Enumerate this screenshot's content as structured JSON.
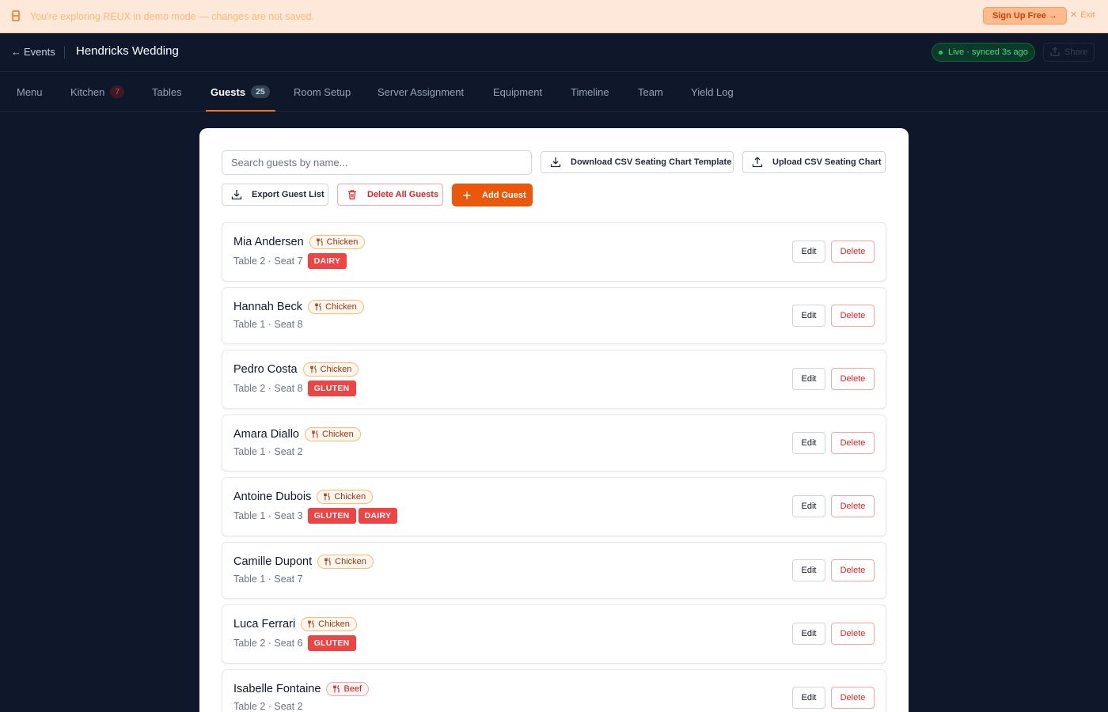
{
  "banner": {
    "message": "You're exploring REUX in demo mode — changes are not saved.",
    "signup_label": "Sign Up Free →",
    "exit_label": "Exit"
  },
  "header": {
    "back_label": "Events",
    "event_title": "Hendricks Wedding",
    "live_status": "Live · synced 3s ago",
    "share_label": "Share"
  },
  "tabs": [
    {
      "label": "Menu"
    },
    {
      "label": "Kitchen",
      "count": "7"
    },
    {
      "label": "Tables"
    },
    {
      "label": "Guests",
      "count": "25",
      "active": true
    },
    {
      "label": "Room Setup"
    },
    {
      "label": "Server Assignment"
    },
    {
      "label": "Equipment"
    },
    {
      "label": "Timeline"
    },
    {
      "label": "Team"
    },
    {
      "label": "Yield Log"
    }
  ],
  "toolbar": {
    "search_placeholder": "Search guests by name...",
    "download_template_label": "Download CSV Seating Chart Template",
    "upload_label": "Upload CSV Seating Chart",
    "export_label": "Export Guest List",
    "delete_all_label": "Delete All Guests",
    "add_label": "Add Guest"
  },
  "row_actions": {
    "edit_label": "Edit",
    "delete_label": "Delete"
  },
  "guests": [
    {
      "name": "Mia Andersen",
      "meal": "Chicken",
      "seat": "Table 2 · Seat 7",
      "allergens": [
        "DAIRY"
      ]
    },
    {
      "name": "Hannah Beck",
      "meal": "Chicken",
      "seat": "Table 1 · Seat 8",
      "allergens": []
    },
    {
      "name": "Pedro Costa",
      "meal": "Chicken",
      "seat": "Table 2 · Seat 8",
      "allergens": [
        "GLUTEN"
      ]
    },
    {
      "name": "Amara Diallo",
      "meal": "Chicken",
      "seat": "Table 1 · Seat 2",
      "allergens": []
    },
    {
      "name": "Antoine Dubois",
      "meal": "Chicken",
      "seat": "Table 1 · Seat 3",
      "allergens": [
        "GLUTEN",
        "DAIRY"
      ]
    },
    {
      "name": "Camille Dupont",
      "meal": "Chicken",
      "seat": "Table 1 · Seat 7",
      "allergens": []
    },
    {
      "name": "Luca Ferrari",
      "meal": "Chicken",
      "seat": "Table 2 · Seat 6",
      "allergens": [
        "GLUTEN"
      ]
    },
    {
      "name": "Isabelle Fontaine",
      "meal": "Beef",
      "seat": "Table 2 · Seat 2",
      "allergens": []
    }
  ],
  "icons": {
    "banner": "warning-icon",
    "download": "download-icon",
    "upload": "upload-icon",
    "trash": "trash-icon",
    "plus": "plus-icon",
    "meal": "utensils-icon",
    "share": "share-icon"
  },
  "colors": {
    "accent": "#ea580c",
    "allergen": "#ef4444",
    "live": "#22c55e",
    "page_bg": "#0f172a"
  }
}
